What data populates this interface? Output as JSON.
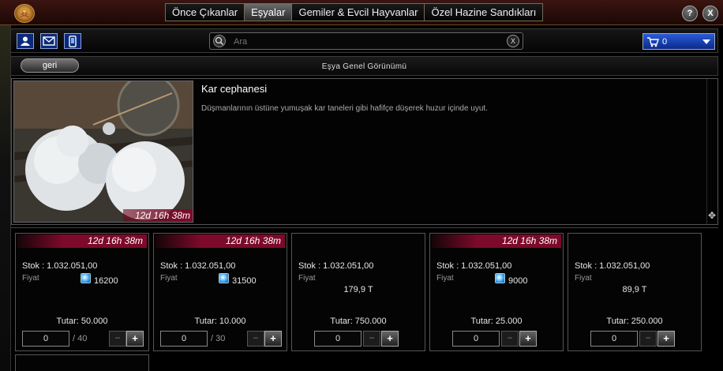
{
  "header": {
    "tabs": [
      {
        "label": "Önce Çıkanlar",
        "active": false
      },
      {
        "label": "Eşyalar",
        "active": true
      },
      {
        "label": "Gemiler & Evcil Hayvanlar",
        "active": false
      },
      {
        "label": "Özel Hazine Sandıkları",
        "active": false
      }
    ],
    "help_label": "?",
    "close_label": "X"
  },
  "toolbar": {
    "search": {
      "value": "",
      "placeholder": "Ara"
    },
    "clear_label": "X",
    "cart_count": "0"
  },
  "subbar": {
    "back_label": "geri",
    "title": "Eşya Genel Görünümü"
  },
  "item": {
    "name": "Kar cephanesi",
    "description": "Düşmanlarının üstüne yumuşak kar taneleri gibi hafifçe düşerek huzur içinde uyut.",
    "timer": "12d 16h 38m"
  },
  "offers": [
    {
      "timer": "12d 16h 38m",
      "stock": "Stok : 1.032.051,00",
      "price_label": "Fiyat",
      "price": "16200",
      "price_type": "gem",
      "total": "Tutar: 50.000",
      "qty": "0",
      "max": "/ 40"
    },
    {
      "timer": "12d 16h 38m",
      "stock": "Stok : 1.032.051,00",
      "price_label": "Fiyat",
      "price": "31500",
      "price_type": "gem",
      "total": "Tutar: 10.000",
      "qty": "0",
      "max": "/ 30"
    },
    {
      "timer": "",
      "stock": "Stok : 1.032.051,00",
      "price_label": "Fiyat",
      "price": "179,9 T",
      "price_type": "money",
      "total": "Tutar: 750.000",
      "qty": "0",
      "max": ""
    },
    {
      "timer": "12d 16h 38m",
      "stock": "Stok : 1.032.051,00",
      "price_label": "Fiyat",
      "price": "9000",
      "price_type": "gem",
      "total": "Tutar: 25.000",
      "qty": "0",
      "max": ""
    },
    {
      "timer": "",
      "stock": "Stok : 1.032.051,00",
      "price_label": "Fiyat",
      "price": "89,9 T",
      "price_type": "money",
      "total": "Tutar: 250.000",
      "qty": "0",
      "max": ""
    }
  ],
  "controls": {
    "minus": "−",
    "plus": "+"
  },
  "icons": {
    "logo": "pirate-emblem-icon",
    "profile": "user-icon",
    "mail": "mail-icon",
    "mobile": "phone-icon",
    "search": "search-icon",
    "cart": "cart-icon",
    "gem": "gem-icon",
    "scroll": "move-icon"
  },
  "colors": {
    "accent_red": "#7d0a2a",
    "cart_blue": "#1a47c0",
    "icon_blue": "#0b2a7a"
  }
}
